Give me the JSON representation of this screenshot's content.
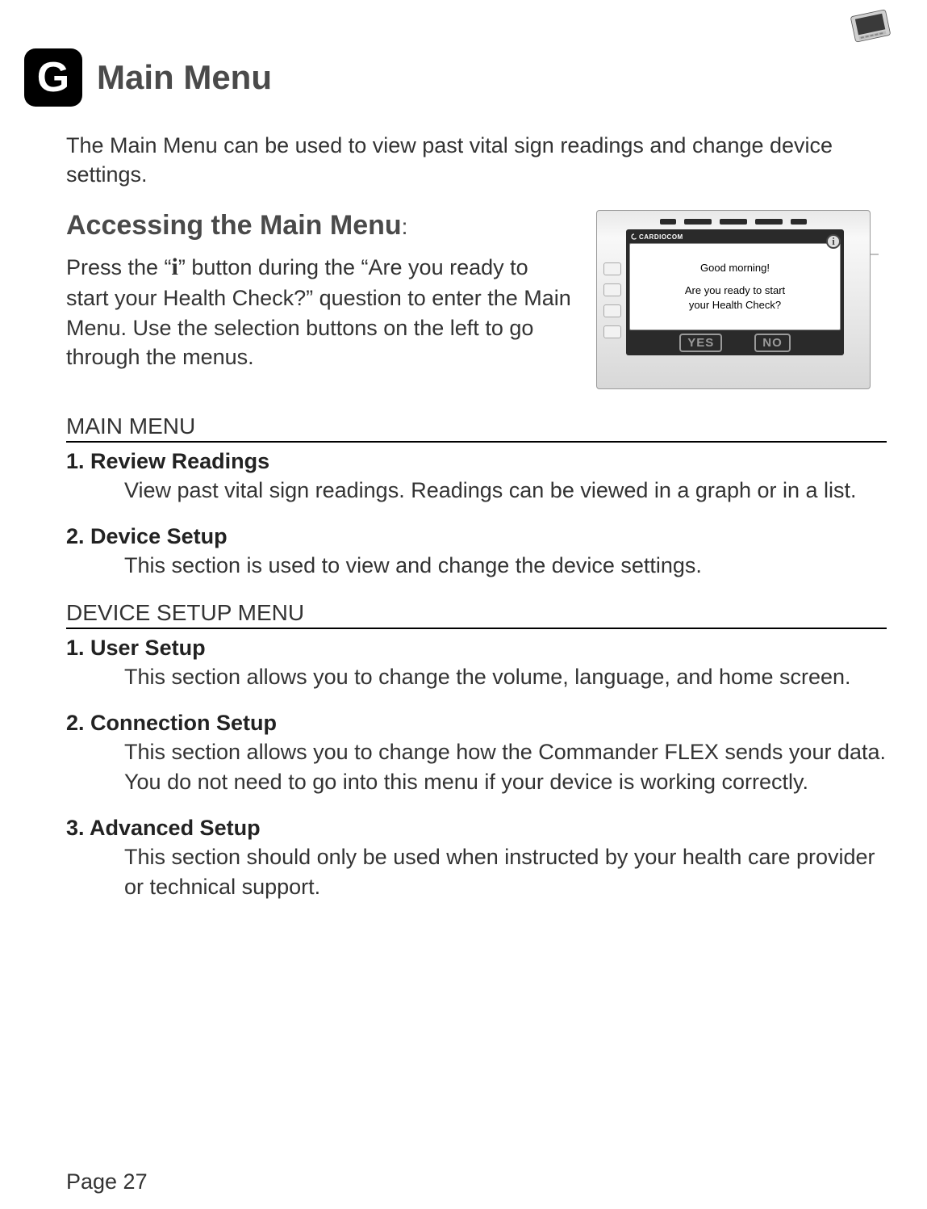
{
  "section_letter": "G",
  "page_title": "Main Menu",
  "intro": "The Main Menu can be used to view past vital sign readings and change device settings.",
  "accessing": {
    "heading": "Accessing the Main Menu",
    "colon": ":",
    "body_pre": "Press the “",
    "info_symbol": "i",
    "body_post": "” button during the “Are you ready to start your Health Check?” question to enter the Main Menu.   Use the selection buttons on the left to go through the menus."
  },
  "device_screen": {
    "brand": "CARDIOCOM",
    "line1": "Good morning!",
    "line2": "Are you ready to start",
    "line3": "your Health Check?",
    "yes_label": "YES",
    "no_label": "NO",
    "info_symbol": "i"
  },
  "menus": [
    {
      "header": "MAIN MENU",
      "items": [
        {
          "title": "1.   Review Readings",
          "body": "View past vital sign readings.  Readings can be viewed in a graph or in a list."
        },
        {
          "title": "2.   Device Setup",
          "body": "This section is used to view and change the device settings."
        }
      ]
    },
    {
      "header": "DEVICE SETUP MENU",
      "items": [
        {
          "title": "1. User Setup",
          "body": "This section allows you to change the volume, language, and home screen."
        },
        {
          "title": "2. Connection Setup",
          "body": "This section allows you to change how the Commander FLEX sends your data.  You do not need to go into this menu if your device is working correctly."
        },
        {
          "title": "3. Advanced Setup",
          "body": "This section should only be used when instructed by your health care provider or technical support."
        }
      ]
    }
  ],
  "page_number": "Page 27"
}
